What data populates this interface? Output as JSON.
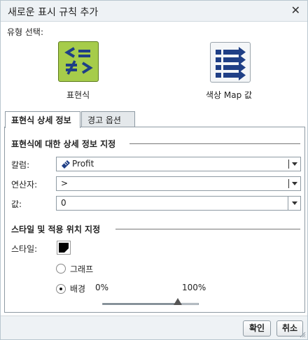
{
  "dialog": {
    "title": "새로운 표시 규칙 추가",
    "close_glyph": "✕"
  },
  "type_select": {
    "label": "유형 선택:",
    "options": [
      {
        "label": "표현식",
        "icon": "expression-icon",
        "selected": true
      },
      {
        "label": "색상 Map 값",
        "icon": "color-map-icon",
        "selected": false
      }
    ]
  },
  "tabs": [
    {
      "label": "표현식 상세 정보",
      "active": true
    },
    {
      "label": "경고 옵션",
      "active": false
    }
  ],
  "details": {
    "section_title": "표현식에 대한 상세 정보 지정",
    "column": {
      "label": "칼럼:",
      "value": "Profit",
      "icon": "measure-icon"
    },
    "operator": {
      "label": "연산자:",
      "value": ">"
    },
    "value": {
      "label": "값:",
      "value": "0"
    }
  },
  "style": {
    "section_title": "스타일 및 적용 위치 지정",
    "style_label": "스타일:",
    "color": "#000000",
    "apply_options": [
      {
        "label": "그래프",
        "selected": false
      },
      {
        "label": "배경",
        "selected": true
      }
    ],
    "transparency": {
      "min_label": "0%",
      "max_label": "100%",
      "value": 0.78
    }
  },
  "footer": {
    "ok_label": "확인",
    "cancel_label": "취소"
  },
  "colors": {
    "accent_green": "#a6cc4a",
    "icon_blue": "#1f3f86",
    "border": "#8e9aa3"
  }
}
